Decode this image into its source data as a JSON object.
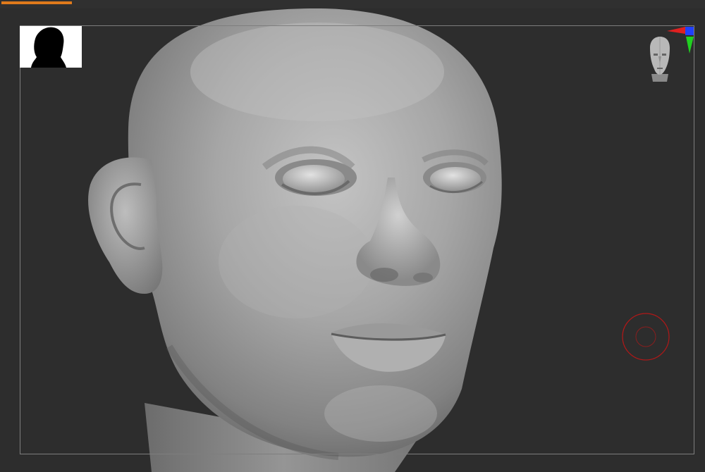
{
  "progress": {
    "value": 0.1,
    "color": "#e07a1c"
  },
  "viewport": {
    "background": "#2d2d2d",
    "model_color": "#a4a4a4"
  },
  "icons": {
    "thumbnail": "silhouette-thumbnail",
    "navigation_head": "navigation-head-icon",
    "axis_gizmo": "axis-gizmo-icon",
    "brush": "brush-cursor-icon"
  },
  "gizmo_colors": {
    "x": "#e02020",
    "y": "#20d020",
    "z": "#2040ff"
  },
  "brush_color": "#b01818"
}
